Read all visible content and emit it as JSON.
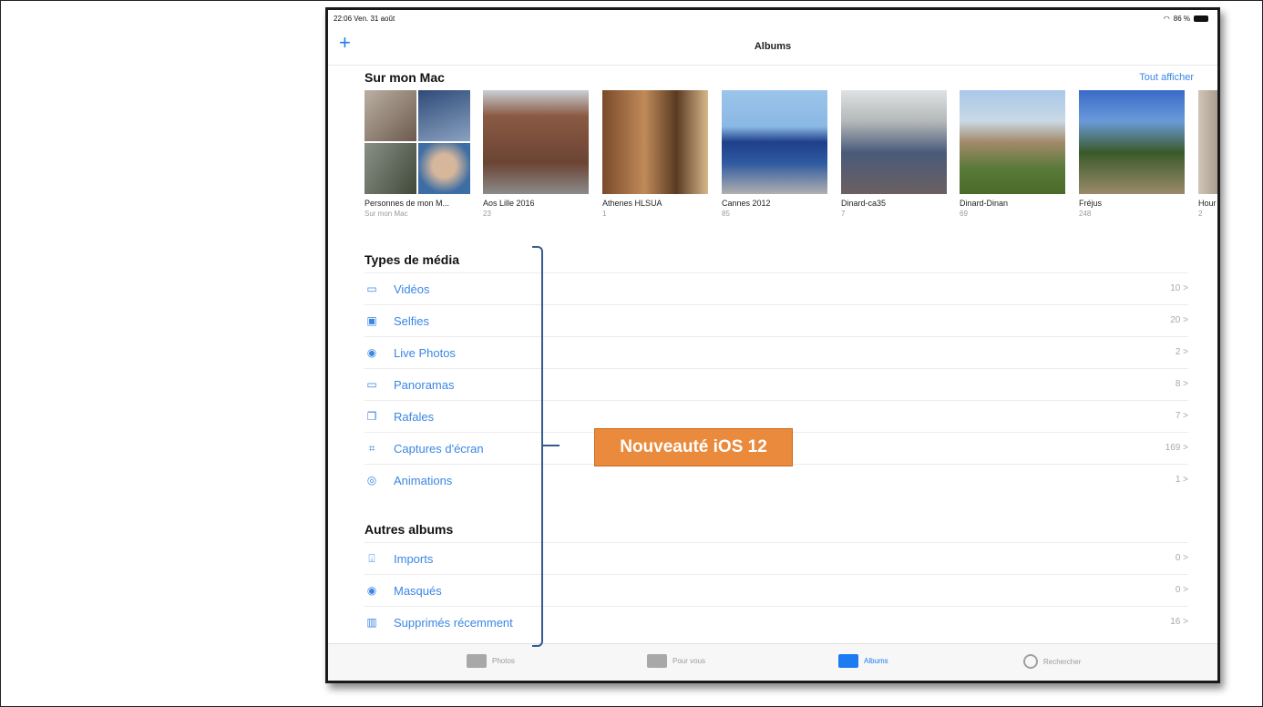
{
  "status": {
    "time": "22:06 Ven. 31 août",
    "battery": "86 %"
  },
  "navbar": {
    "add": "+",
    "title": "Albums"
  },
  "my_mac": {
    "heading": "Sur mon Mac",
    "see_all": "Tout afficher",
    "albums": [
      {
        "name": "Personnes de mon M...",
        "count": "Sur mon Mac"
      },
      {
        "name": "Aos Lille 2016",
        "count": "23"
      },
      {
        "name": "Athenes HLSUA",
        "count": "1"
      },
      {
        "name": "Cannes 2012",
        "count": "85"
      },
      {
        "name": "Dinard-ca35",
        "count": "7"
      },
      {
        "name": "Dinard-Dinan",
        "count": "69"
      },
      {
        "name": "Fréjus",
        "count": "248"
      },
      {
        "name": "Hour",
        "count": "2"
      }
    ]
  },
  "media_types": {
    "heading": "Types de média",
    "items": [
      {
        "label": "Vidéos",
        "count": "10 >"
      },
      {
        "label": "Selfies",
        "count": "20 >"
      },
      {
        "label": "Live Photos",
        "count": "2 >"
      },
      {
        "label": "Panoramas",
        "count": "8 >"
      },
      {
        "label": "Rafales",
        "count": "7 >"
      },
      {
        "label": "Captures d'écran",
        "count": "169 >"
      },
      {
        "label": "Animations",
        "count": "1 >"
      }
    ]
  },
  "other_albums": {
    "heading": "Autres albums",
    "items": [
      {
        "label": "Imports",
        "count": "0 >"
      },
      {
        "label": "Masqués",
        "count": "0 >"
      },
      {
        "label": "Supprimés récemment",
        "count": "16 >"
      }
    ]
  },
  "tabbar": {
    "photos": "Photos",
    "for_you": "Pour vous",
    "albums": "Albums",
    "search": "Rechercher"
  },
  "callout": "Nouveauté iOS 12",
  "colors": {
    "accent": "#1e7cf2",
    "callout": "#ea8a3c"
  }
}
